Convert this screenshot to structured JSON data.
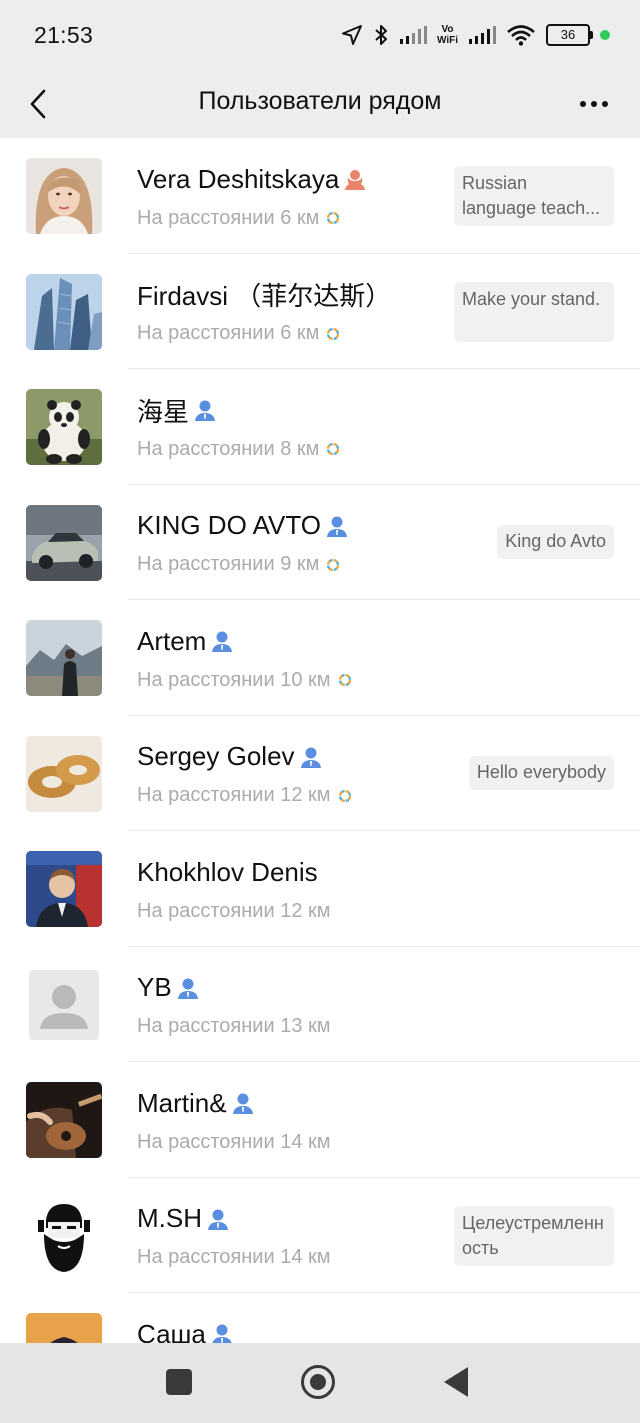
{
  "status": {
    "time": "21:53",
    "vowifi_top": "Vo",
    "vowifi_bottom": "WiFi",
    "battery": "36"
  },
  "navbar": {
    "title": "Пользователи рядом"
  },
  "colors": {
    "accent_green": "#2ecc5b",
    "female_icon": "#e8846b",
    "male_icon": "#5a8ee0"
  },
  "users": [
    {
      "name": "Vera Deshitskaya",
      "distance": "На расстоянии 6 км",
      "gender": "female",
      "signature": "Russian language teach...",
      "avatar": "woman-portrait"
    },
    {
      "name": "Firdavsi （菲尔达斯）",
      "distance": "На расстоянии 6 км",
      "gender": "",
      "signature": "Make your stand.",
      "avatar": "skyscrapers"
    },
    {
      "name": "海星",
      "distance": "На расстоянии 8 км",
      "gender": "male",
      "signature": "",
      "avatar": "panda"
    },
    {
      "name": "KING DO AVTO",
      "distance": "На расстоянии 9 км",
      "gender": "male",
      "signature": "King do Avto",
      "avatar": "car"
    },
    {
      "name": "Artem",
      "distance": "На расстоянии 10 км",
      "gender": "male",
      "signature": "",
      "avatar": "mountains-person"
    },
    {
      "name": "Sergey Golev",
      "distance": "На расстоянии 12 км",
      "gender": "male",
      "signature": "Hello everybody",
      "avatar": "bagels"
    },
    {
      "name": "Khokhlov Denis",
      "distance": "На расстоянии 12 км",
      "gender": "",
      "signature": "",
      "avatar": "man-suit"
    },
    {
      "name": "YB",
      "distance": "На расстоянии 13 км",
      "gender": "male",
      "signature": "",
      "avatar": "default"
    },
    {
      "name": "Martin&",
      "distance": "На расстоянии 14 км",
      "gender": "male",
      "signature": "",
      "avatar": "guitar"
    },
    {
      "name": "M.SH",
      "distance": "На расстоянии 14 км",
      "gender": "male",
      "signature": "Целеустремленность",
      "avatar": "bearded-man"
    },
    {
      "name": "Саша",
      "distance": "",
      "gender": "male",
      "signature": "",
      "avatar": "anime"
    }
  ]
}
